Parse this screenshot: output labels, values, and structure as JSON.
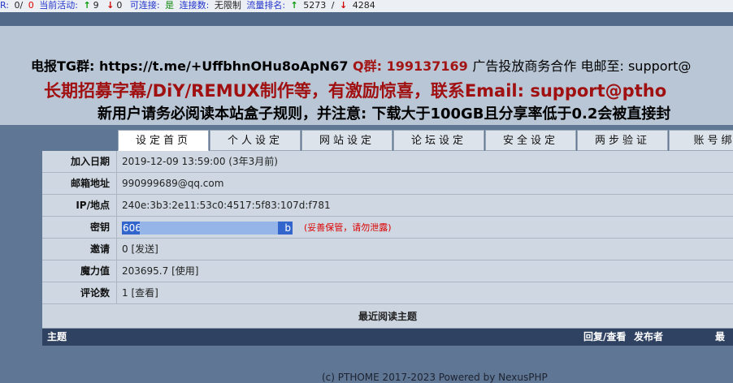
{
  "status": {
    "ratio_label": "R:",
    "ratio_value": "0/",
    "active_count": "0",
    "active_label": "当前活动:",
    "seeding": "9",
    "leeching": "0",
    "connectable_label": "可连接:",
    "connectable_value": "是",
    "connections_label": "连接数:",
    "connections_value": "无限制",
    "rank_label": "流量排名:",
    "rank_up": "5273",
    "rank_sep": "/",
    "rank_down": "4284",
    "colors": {
      "blue": "#2233cc",
      "red": "#dd0000",
      "green": "#118811"
    }
  },
  "announcement": {
    "line1_prefix": "电报TG群: https://t.me/+UffbhnOHu8oApN67",
    "line1_qq": "Q群: 199137169",
    "line1_suffix": "广告投放商务合作 电邮至: support@",
    "line2": "长期招募字幕/DiY/REMUX制作等，有激励惊喜，联系Email: support@ptho",
    "line3": "新用户请务必阅读本站盒子规则，并注意: 下载大于100GB且分享率低于0.2会被直接封"
  },
  "tabs": [
    "设定首页",
    "个人设定",
    "网站设定",
    "论坛设定",
    "安全设定",
    "两步验证",
    "账号绑"
  ],
  "profile": {
    "join_label": "加入日期",
    "join_value": "2019-12-09 13:59:00 (3年3月前)",
    "email_label": "邮箱地址",
    "email_value": "990999689@qq.com",
    "ip_label": "IP/地点",
    "ip_value": "240e:3b3:2e11:53c0:4517:5f83:107d:f781",
    "passkey_label": "密钥",
    "passkey_start": "606",
    "passkey_end": "b",
    "passkey_warning": "(妥善保管，请勿泄露)",
    "invite_label": "邀请",
    "invite_count": "0",
    "invite_link": "[发送]",
    "bonus_label": "魔力值",
    "bonus_value": "203695.7",
    "bonus_link": "[使用]",
    "comments_label": "评论数",
    "comments_count": "1",
    "comments_link": "[查看]"
  },
  "recent": {
    "title": "最近阅读主题",
    "col_subject": "主题",
    "col_replies": "回复/查看",
    "col_author": "发布者",
    "col_last": "最后"
  },
  "footer": "(c) PTHOME 2017-2023 Powered by NexusPHP"
}
